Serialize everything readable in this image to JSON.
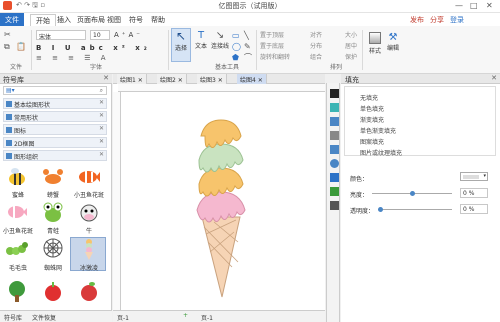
{
  "window": {
    "title": "亿图图示（试用版）",
    "minimize": "—",
    "maximize": "□",
    "close": "✕"
  },
  "menu": {
    "file": "文件",
    "items": [
      "开始",
      "插入",
      "页面布局",
      "视图",
      "符号",
      "帮助"
    ],
    "publish": "发布",
    "share": "分享",
    "login": "登录"
  },
  "ribbon": {
    "font_name": "宋体",
    "font_size": "10",
    "select": "选择",
    "text": "文本",
    "connector": "连接线",
    "bring_front": "置于顶层",
    "send_back": "置于底层",
    "group": "组合",
    "align": "对齐",
    "distribute": "分布",
    "size": "大小",
    "rotate_flip": "旋转和翻转",
    "center": "居中",
    "protect": "保护",
    "style": "样式",
    "edit": "编辑",
    "groups": {
      "file": "文件",
      "font": "字体",
      "basic_tools": "基本工具",
      "arrange": "排列"
    }
  },
  "library": {
    "title": "符号库",
    "items": [
      "基本绘图形状",
      "常用形状",
      "图标",
      "2D框图",
      "图形组织"
    ],
    "symbols": [
      "蜜蜂",
      "螃蟹",
      "小丑鱼花斑",
      "小丑鱼花斑",
      "青蛙",
      "牛",
      "毛毛虫",
      "蜘蛛网",
      "冰激凌"
    ]
  },
  "bottom_tabs": [
    "符号库",
    "文件恢复"
  ],
  "tabs": [
    "绘图1",
    "绘图2",
    "绘图3",
    "绘图4"
  ],
  "status": {
    "page": "页-1",
    "page2": "页-1"
  },
  "fill": {
    "title": "填充",
    "options": [
      "无填充",
      "单色填充",
      "渐变填充",
      "单色渐变填充",
      "图案填充",
      "图片或纹理填充"
    ],
    "color_label": "颜色：",
    "brightness_label": "亮度：",
    "brightness_value": "0 %",
    "transparency_label": "透明度：",
    "transparency_value": "0 %"
  },
  "colors": {
    "accent": "#2c72c7",
    "scoop_orange": "#f7c46c",
    "scoop_green": "#c9e3c0",
    "scoop_pink": "#f5b8cf",
    "cone": "#f6d4b5"
  }
}
